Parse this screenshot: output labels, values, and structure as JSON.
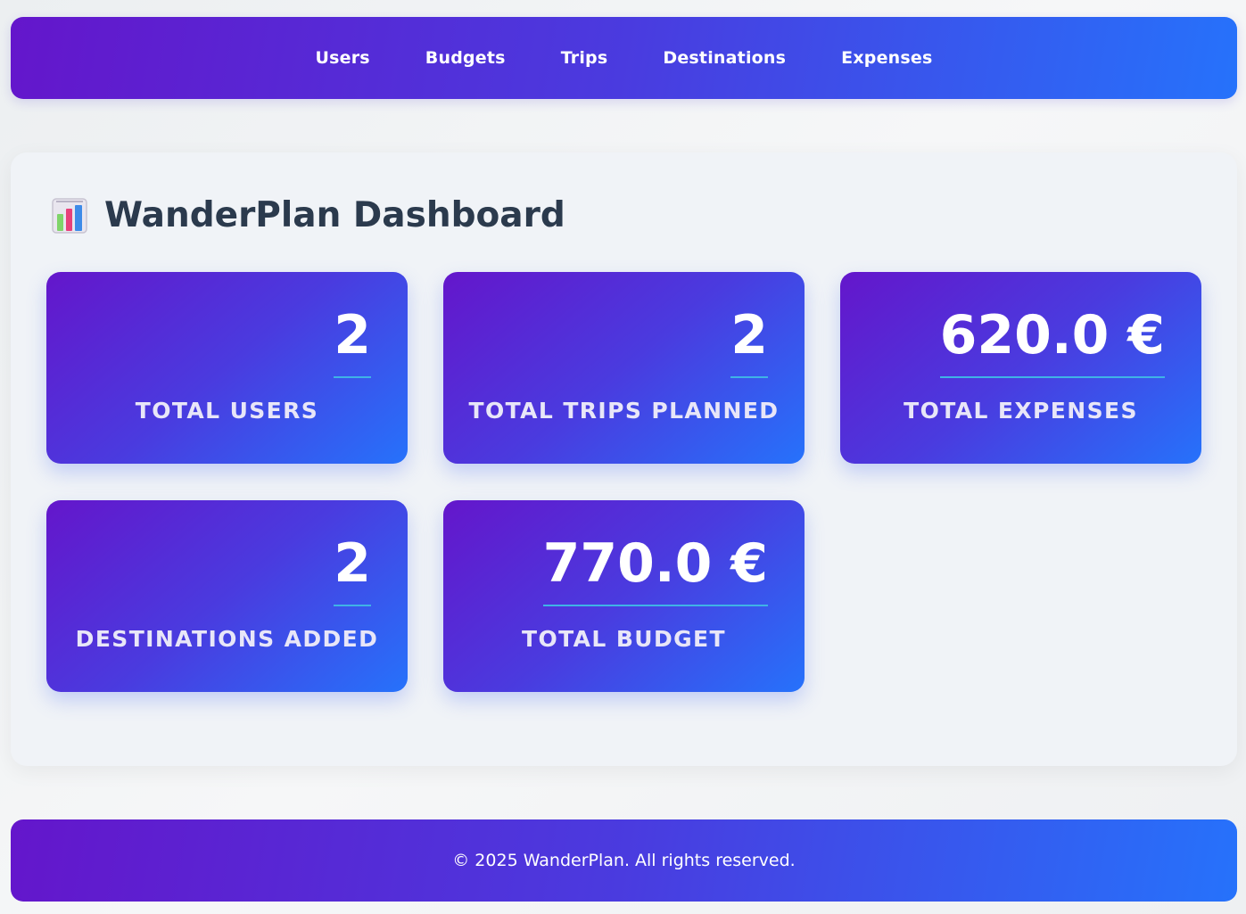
{
  "nav": {
    "items": [
      {
        "label": "Users"
      },
      {
        "label": "Budgets"
      },
      {
        "label": "Trips"
      },
      {
        "label": "Destinations"
      },
      {
        "label": "Expenses"
      }
    ]
  },
  "dashboard": {
    "title_icon": "bar-chart-icon",
    "title": "WanderPlan Dashboard",
    "stats": [
      {
        "value": "2",
        "label": "TOTAL USERS"
      },
      {
        "value": "2",
        "label": "TOTAL TRIPS PLANNED"
      },
      {
        "value": "620.0 €",
        "label": "TOTAL EXPENSES"
      },
      {
        "value": "2",
        "label": "DESTINATIONS ADDED"
      },
      {
        "value": "770.0 €",
        "label": "TOTAL BUDGET"
      }
    ]
  },
  "footer": {
    "text": "© 2025 WanderPlan. All rights reserved."
  },
  "colors": {
    "gradient_start": "#6416cb",
    "gradient_end": "#2672fb",
    "title_text": "#2b3a4d",
    "underline": "#3fb3e6",
    "card_background": "#f0f3f7"
  }
}
